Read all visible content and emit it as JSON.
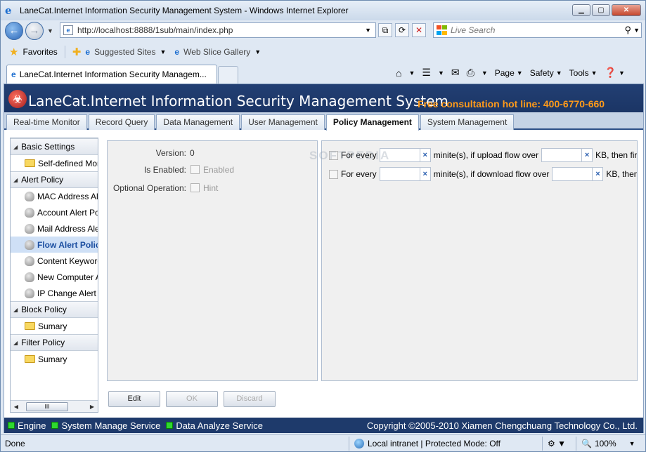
{
  "browser": {
    "window_title": "LaneCat.Internet Information Security Management System - Windows Internet Explorer",
    "url": "http://localhost:8888/1sub/main/index.php",
    "search_placeholder": "Live Search",
    "favorites_label": "Favorites",
    "suggested_sites": "Suggested Sites",
    "web_slice_gallery": "Web Slice Gallery",
    "tab_title": "LaneCat.Internet Information Security Managem...",
    "cmd": {
      "page": "Page",
      "safety": "Safety",
      "tools": "Tools"
    },
    "status_done": "Done",
    "zone": "Local intranet | Protected Mode: Off",
    "zoom": "100%"
  },
  "app": {
    "title": "LaneCat.Internet Information Security Management System",
    "hotline": "Free consultation hot line: 400-6770-660",
    "tabs": [
      "Real-time Monitor",
      "Record Query",
      "Data Management",
      "User Management",
      "Policy Management",
      "System Management"
    ],
    "active_tab": "Policy Management"
  },
  "sidebar": {
    "basic_settings": "Basic Settings",
    "self_defined": "Self-defined Monit",
    "alert_policy": "Alert Policy",
    "alerts": [
      "MAC Address Ale",
      "Account Alert Poli",
      "Mail Address Aler",
      "Flow Alert Policy",
      "Content Keyword",
      "New Computer Al",
      "IP Change Alert Po"
    ],
    "block_policy": "Block Policy",
    "block_summary": "Sumary",
    "filter_policy": "Filter Policy",
    "filter_summary": "Sumary",
    "scroll_thumb": "III"
  },
  "form": {
    "version_label": "Version:",
    "version_value": "0",
    "enabled_label": "Is Enabled:",
    "enabled_text": "Enabled",
    "optional_label": "Optional Operation:",
    "hint_text": "Hint"
  },
  "rules": {
    "upload": {
      "prefix": "For every",
      "middle": "minite(s), if upload flow over",
      "suffix": "KB, then fire a"
    },
    "download": {
      "prefix": "For every",
      "middle": "minite(s), if download flow over",
      "suffix": "KB, then fi"
    },
    "clear_glyph": "×"
  },
  "watermark": "SOFTPEDIA",
  "buttons": {
    "edit": "Edit",
    "ok": "OK",
    "discard": "Discard"
  },
  "services": {
    "engine": "Engine",
    "system": "System Manage Service",
    "analyze": "Data Analyze Service"
  },
  "copyright": "Copyright ©2005-2010 Xiamen Chengchuang Technology Co., Ltd.",
  "colors": {
    "header": "#1b3565",
    "hotline": "#ff9a1a",
    "status_on": "#2ed82e"
  }
}
